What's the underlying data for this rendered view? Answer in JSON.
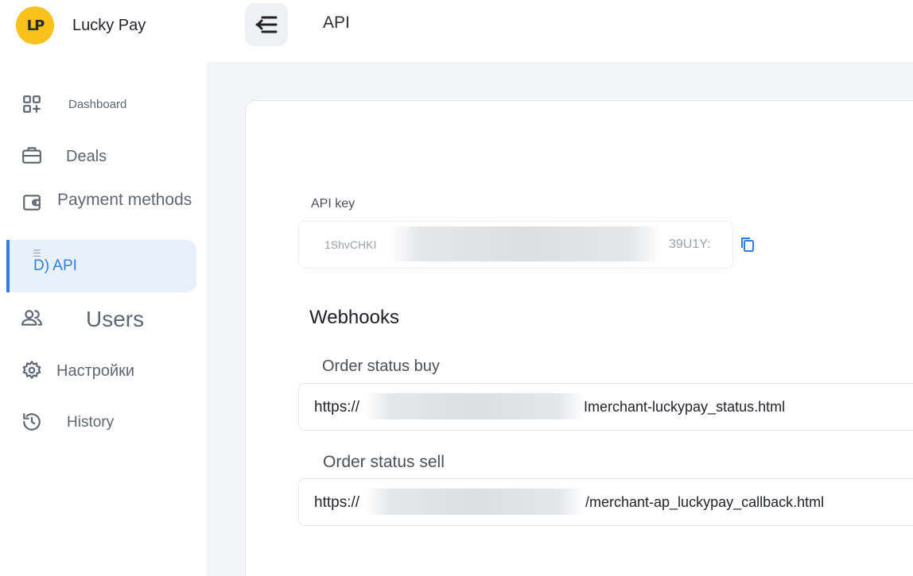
{
  "brand": {
    "name": "Lucky Pay",
    "logo_text": "LP",
    "logo_color": "#f7c21a"
  },
  "sidebar": {
    "items": [
      {
        "label": "Dashboard",
        "icon": "dashboard-grid-icon"
      },
      {
        "label": "Deals",
        "icon": "briefcase-icon"
      },
      {
        "label": "Payment methods",
        "icon": "wallet-icon"
      },
      {
        "label": "D) API",
        "icon": "api-icon",
        "active": true
      },
      {
        "label": "Users",
        "icon": "users-icon"
      },
      {
        "label": "Настройки",
        "icon": "gear-icon"
      },
      {
        "label": "History",
        "icon": "history-icon"
      }
    ]
  },
  "header": {
    "title": "API",
    "menu_icon": "menu-collapse-icon"
  },
  "api_key": {
    "label": "API key",
    "value_start": "1ShvCHKI",
    "value_end": "39U1Y:",
    "copy_icon": "copy-icon"
  },
  "webhooks": {
    "title": "Webhooks",
    "buy": {
      "label": "Order status buy",
      "prefix": "https://",
      "suffix": "Imerchant-luckypay_status.html"
    },
    "sell": {
      "label": "Order status sell",
      "prefix": "https://",
      "suffix": "/merchant-ap_luckypay_callback.html"
    }
  },
  "colors": {
    "accent": "#2f7ee8",
    "active_bg": "#e8f0fb",
    "background": "#f4f5f7"
  }
}
